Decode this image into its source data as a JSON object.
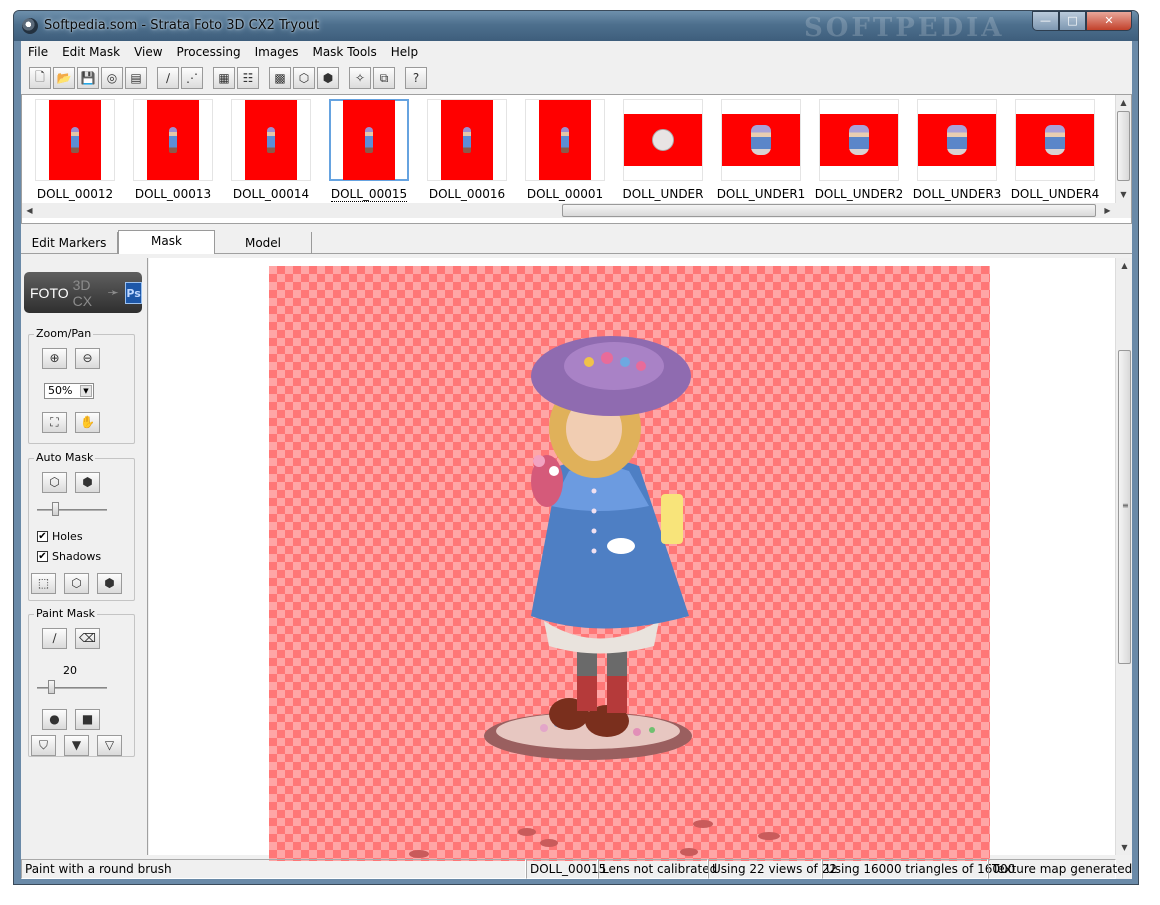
{
  "window": {
    "title": "Softpedia.som - Strata Foto 3D CX2 Tryout",
    "watermark": "SOFTPEDIA",
    "controls": {
      "minimize": "—",
      "maximize": "□",
      "close": "✕"
    }
  },
  "menu": [
    "File",
    "Edit Mask",
    "View",
    "Processing",
    "Images",
    "Mask Tools",
    "Help"
  ],
  "toolbar": {
    "buttons": [
      {
        "name": "new-icon",
        "glyph": "🗋"
      },
      {
        "name": "open-icon",
        "glyph": "📂"
      },
      {
        "name": "save-icon",
        "glyph": "💾"
      },
      {
        "name": "target-icon",
        "glyph": "◎"
      },
      {
        "name": "properties-icon",
        "glyph": "▤"
      },
      {
        "name": "brush-icon",
        "glyph": "∕"
      },
      {
        "name": "wand-icon",
        "glyph": "⋰"
      },
      {
        "name": "grid-view-icon",
        "glyph": "▦"
      },
      {
        "name": "list-view-icon",
        "glyph": "☷"
      },
      {
        "name": "checker-icon",
        "glyph": "▩"
      },
      {
        "name": "cube-icon",
        "glyph": "⬡"
      },
      {
        "name": "cube-solid-icon",
        "glyph": "⬢"
      },
      {
        "name": "mesh-icon",
        "glyph": "✧"
      },
      {
        "name": "export-icon",
        "glyph": "⧉"
      },
      {
        "name": "help-icon",
        "glyph": "?"
      }
    ]
  },
  "thumbnails": [
    {
      "label": "DOLL_00012",
      "kind": "tall"
    },
    {
      "label": "DOLL_00013",
      "kind": "tall"
    },
    {
      "label": "DOLL_00014",
      "kind": "tall"
    },
    {
      "label": "DOLL_00015",
      "kind": "tall",
      "selected": true
    },
    {
      "label": "DOLL_00016",
      "kind": "tall"
    },
    {
      "label": "DOLL_00001",
      "kind": "tall"
    },
    {
      "label": "DOLL_UNDER",
      "kind": "plate"
    },
    {
      "label": "DOLL_UNDER1",
      "kind": "wide"
    },
    {
      "label": "DOLL_UNDER2",
      "kind": "wide"
    },
    {
      "label": "DOLL_UNDER3",
      "kind": "wide"
    },
    {
      "label": "DOLL_UNDER4",
      "kind": "wide"
    }
  ],
  "tabs": [
    {
      "label": "Edit Markers",
      "active": false
    },
    {
      "label": "Mask",
      "active": true
    },
    {
      "label": "Model",
      "active": false
    }
  ],
  "sidebar": {
    "logo": {
      "foto": "FOTO",
      "cx": "3D CX",
      "arrow": "➛",
      "ps": "Ps"
    },
    "zoom_pan": {
      "title": "Zoom/Pan",
      "zoom_value": "50%",
      "zoom_in": "⊕",
      "zoom_out": "⊖",
      "fit": "⛶",
      "pan": "✋"
    },
    "auto_mask": {
      "title": "Auto Mask",
      "holes_label": "Holes",
      "holes_checked": true,
      "shadows_label": "Shadows",
      "shadows_checked": true,
      "slider_level": 0.25
    },
    "paint_mask": {
      "title": "Paint Mask",
      "brush_size": "20",
      "slider_level": 0.2
    }
  },
  "status": {
    "hint": "Paint with a round brush",
    "image": "DOLL_00015",
    "lens": "Lens not calibrated",
    "views": "Using 22 views of 22",
    "triangles": "Using 16000 triangles of 16000",
    "texture": "Texture map generated"
  },
  "colors": {
    "mask_red": "#ff0000",
    "checker_dark": "#ff7777",
    "checker_light": "#ffa6a6",
    "selection": "#66a3e0"
  }
}
